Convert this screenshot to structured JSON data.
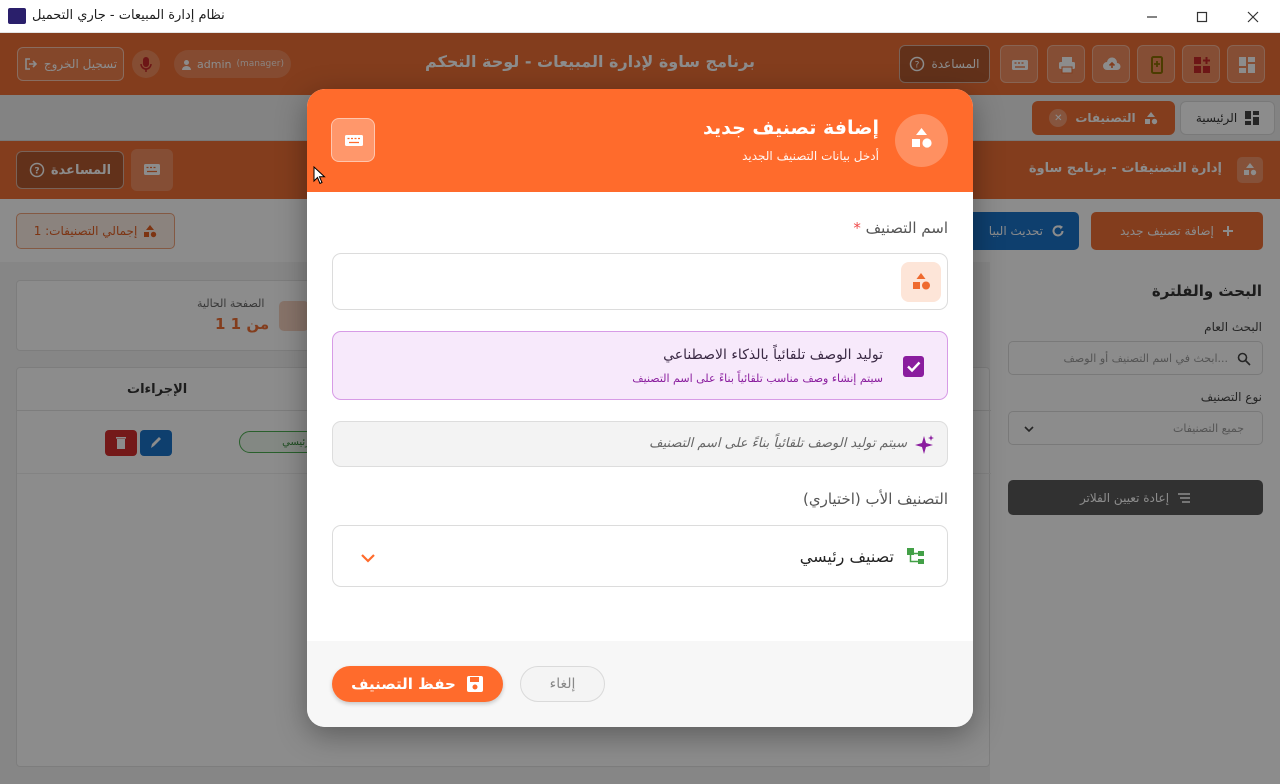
{
  "window": {
    "title": "نظام إدارة المبيعات - جاري التحميل",
    "app_icon_text": "SAWA POS"
  },
  "header": {
    "app_title": "برنامج ساوة لإدارة المبيعات - لوحة التحكم",
    "help_label": "المساعدة",
    "user_name": "admin",
    "user_role": "(manager)",
    "logout_label": "تسجيل الخروج"
  },
  "tabs": [
    {
      "label": "الرئيسية",
      "active": false
    },
    {
      "label": "التصنيفات",
      "active": true
    }
  ],
  "page_header": {
    "title": "إدارة التصنيفات - برنامج ساوة",
    "help_label": "المساعدة"
  },
  "toolbar": {
    "add_label": "إضافة تصنيف جديد",
    "refresh_label": "تحديث البيا",
    "total_label": "إجمالي التصنيفات: 1"
  },
  "filters": {
    "title": "البحث والفلترة",
    "search_label": "البحث العام",
    "search_placeholder": "ابحث في اسم التصنيف أو الوصف...",
    "type_label": "نوع التصنيف",
    "type_value": "جميع التصنيفات",
    "reset_label": "إعادة تعيين الفلاتر"
  },
  "pagination": {
    "current_label": "الصفحة الحالية",
    "current_value": "1 من 1"
  },
  "table": {
    "actions_header": "الإجراءات",
    "row_type": "رئيسي"
  },
  "modal": {
    "title": "إضافة تصنيف جديد",
    "subtitle": "أدخل بيانات التصنيف الجديد",
    "name_label": "اسم التصنيف",
    "required_mark": "*",
    "name_value": "",
    "ai_title": "توليد الوصف تلقائياً بالذكاء الاصطناعي",
    "ai_subtitle": "سيتم إنشاء وصف مناسب تلقائياً بناءً على اسم التصنيف",
    "ai_checked": true,
    "desc_placeholder": "سيتم توليد الوصف تلقائياً بناءً على اسم التصنيف",
    "parent_label": "التصنيف الأب (اختياري)",
    "parent_value": "تصنيف رئيسي",
    "save_label": "حفظ التصنيف",
    "cancel_label": "إلغاء"
  },
  "colors": {
    "brand": "#ef7036",
    "modal_accent": "#ff6b2c",
    "ai_purple": "#8a1d9e",
    "refresh_blue": "#1a74c9",
    "danger": "#d32f2f"
  }
}
